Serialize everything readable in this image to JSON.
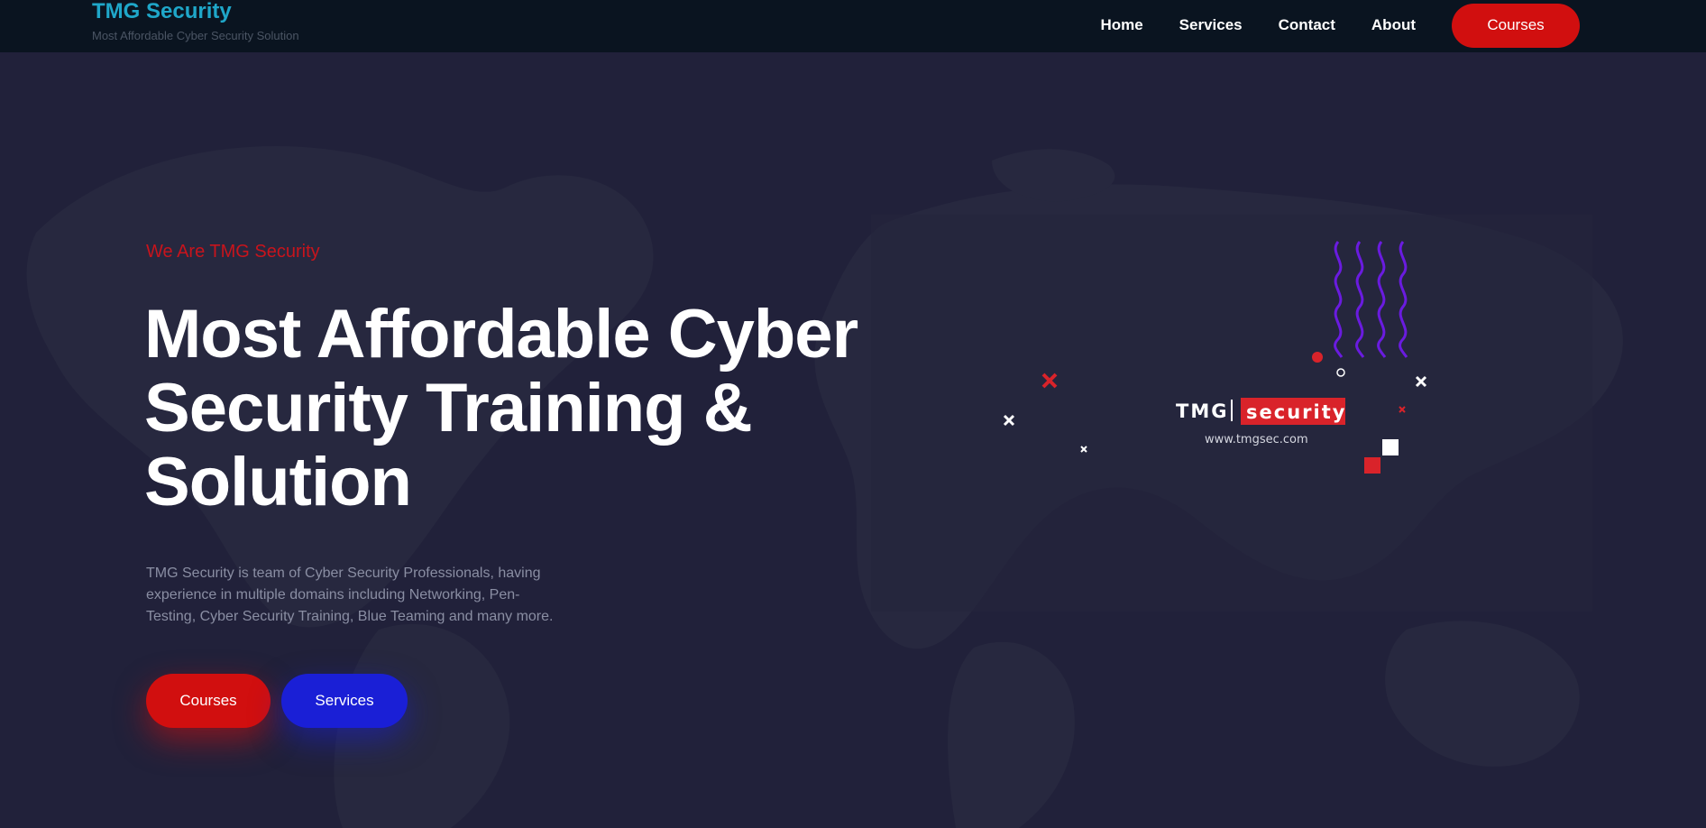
{
  "header": {
    "brand_title": "TMG Security",
    "brand_tagline": "Most Affordable Cyber Security Solution",
    "nav": [
      "Home",
      "Services",
      "Contact",
      "About"
    ],
    "cta_label": "Courses"
  },
  "hero": {
    "kicker": "We Are TMG Security",
    "title_lines": [
      "Most Affordable Cyber",
      "Security Training &",
      "Solution"
    ],
    "description": "TMG Security is team of Cyber Security Professionals, having experience in multiple domains including Networking, Pen-Testing, Cyber Security Training, Blue Teaming and many more.",
    "primary_button": "Courses",
    "secondary_button": "Services"
  },
  "logo": {
    "word_left": "TMG",
    "word_right": "security",
    "url": "www.tmgsec.com"
  },
  "colors": {
    "background": "#21213a",
    "header_bg": "#0a1420",
    "accent_red": "#d10f0f",
    "accent_blue": "#1a1fd6",
    "brand_cyan": "#1fa7c9",
    "wave_purple": "#6a1be0"
  }
}
